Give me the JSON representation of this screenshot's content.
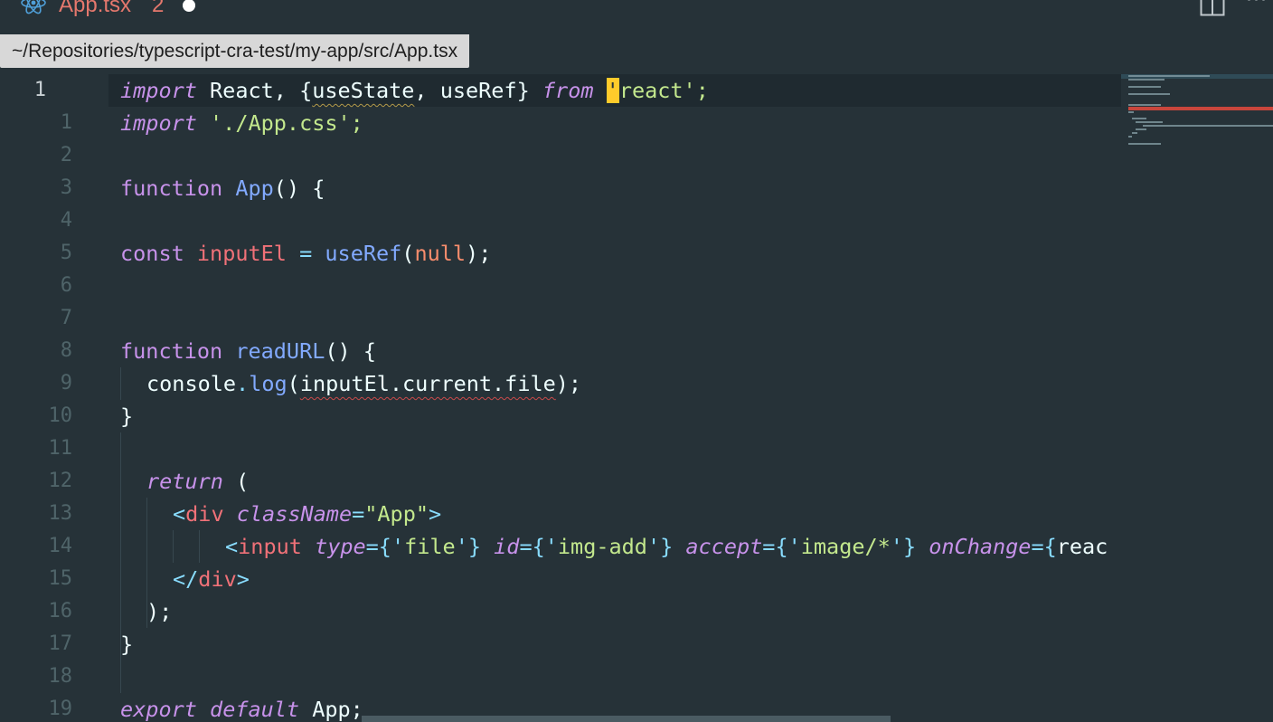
{
  "tab": {
    "title": "App.tsx",
    "problem_count": "2",
    "icon": "react-icon",
    "dirty": true
  },
  "toolbar": {
    "split_icon": "split-editor-icon",
    "more_icon": "more-actions-icon",
    "more_glyph": "···"
  },
  "path_tooltip": "~/Repositories/typescript-cra-test/my-app/src/App.tsx",
  "colors": {
    "background": "#263238",
    "keyword": "#c792ea",
    "function": "#82aaff",
    "string": "#c3e88d",
    "variable": "#f07178",
    "null": "#f78c6c",
    "cursor": "#ffcb2b",
    "tab_title": "#e5786d"
  },
  "gutter": {
    "current_line_number": "1",
    "line_numbers": [
      "1",
      "2",
      "3",
      "4",
      "5",
      "6",
      "7",
      "8",
      "9",
      "10",
      "11",
      "12",
      "13",
      "14",
      "15",
      "16",
      "17",
      "18",
      "19"
    ]
  },
  "code": {
    "l0": {
      "a": "import",
      "b": " React, {",
      "c": "useState",
      "d": ", useRef} ",
      "e": "from",
      "f": " ",
      "g": "'",
      "h": "react';"
    },
    "l1": {
      "a": "import",
      "b": " './App.css';"
    },
    "l3": {
      "a": "function",
      "b": " ",
      "c": "App",
      "d": "() {"
    },
    "l5": {
      "a": "const",
      "b": " ",
      "c": "inputEl",
      "d": " = ",
      "e": "useRef",
      "f": "(",
      "g": "null",
      "h": ");"
    },
    "l8": {
      "a": "function",
      "b": " ",
      "c": "readURL",
      "d": "() {"
    },
    "l9": {
      "a": "console",
      "b": ".",
      "c": "log",
      "d": "(",
      "e": "inputEl.current.file",
      "f": ");"
    },
    "l10": {
      "a": "}"
    },
    "l12": {
      "a": "return",
      "b": " ("
    },
    "l13": {
      "a": "<",
      "b": "div",
      "c": " ",
      "d": "className",
      "e": "=",
      "f": "\"App\"",
      "g": ">"
    },
    "l14": {
      "a": "<",
      "b": "input",
      "c": " ",
      "d": "type",
      "e": "={'",
      "f": "file",
      "g": "'} ",
      "h": "id",
      "i": "={'",
      "j": "img-add",
      "k": "'} ",
      "l": "accept",
      "m": "={'",
      "n": "image/*",
      "o": "'} ",
      "p": "onChange",
      "q": "={",
      "r": "reac"
    },
    "l15": {
      "a": "</",
      "b": "div",
      "c": ">"
    },
    "l16": {
      "a": ");"
    },
    "l17": {
      "a": "}"
    },
    "l19": {
      "a": "export",
      "b": " ",
      "c": "default",
      "d": " App;"
    }
  }
}
